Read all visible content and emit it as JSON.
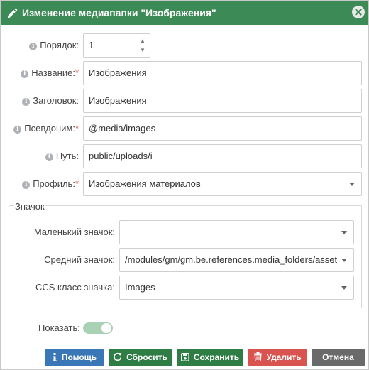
{
  "dialog": {
    "title": "Изменение медиапапки \"Изображения\""
  },
  "form": {
    "order": {
      "label": "Порядок:",
      "value": "1",
      "up": "▲",
      "down": "▼"
    },
    "name": {
      "label": "Название:",
      "value": "Изображения"
    },
    "heading": {
      "label": "Заголовок:",
      "value": "Изображения"
    },
    "alias": {
      "label": "Псевдоним:",
      "value": "@media/images"
    },
    "path": {
      "label": "Путь:",
      "value": "public/uploads/i"
    },
    "profile": {
      "label": "Профиль:",
      "value": "Изображения материалов"
    },
    "required_mark": "*",
    "info_glyph": "i"
  },
  "icon_group": {
    "legend": "Значок",
    "small": {
      "label": "Маленький значок:",
      "value": ""
    },
    "medium": {
      "label": "Средний значок:",
      "value": "/modules/gm/gm.be.references.media_folders/asset"
    },
    "css": {
      "label": "CCS класс значка:",
      "value": "Images"
    }
  },
  "show": {
    "label": "Показать:",
    "on": true
  },
  "buttons": {
    "help": "Помощь",
    "reset": "Сбросить",
    "save": "Сохранить",
    "delete": "Удалить",
    "cancel": "Отмена"
  },
  "colors": {
    "titlebar": "#3c8a55",
    "help": "#3a77b6",
    "success": "#2e7d44",
    "danger": "#d9534f",
    "cancel": "#6a6a6a",
    "toggle_on": "#a9d2b5"
  },
  "icons": {
    "title": "pencil-icon",
    "close": "close-icon",
    "info": "info-icon",
    "help": "info-icon",
    "reset": "refresh-icon",
    "save": "floppy-icon",
    "delete": "trash-icon"
  }
}
